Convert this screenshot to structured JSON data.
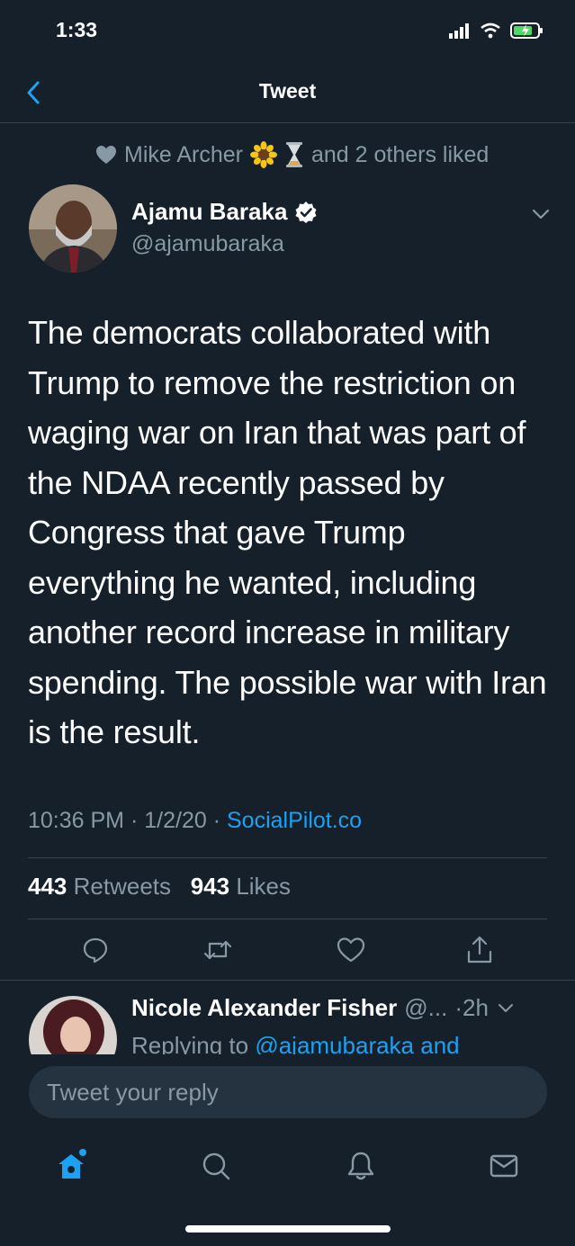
{
  "status_bar": {
    "time": "1:33"
  },
  "nav": {
    "title": "Tweet"
  },
  "social_context": {
    "liker": "Mike Archer",
    "suffix": "and 2 others liked"
  },
  "tweet": {
    "author_name": "Ajamu Baraka",
    "handle": "@ajamubaraka",
    "text": "The democrats collaborated with Trump to remove the restriction on waging war on Iran that was part of the NDAA recently passed by Congress that gave Trump everything he wanted, including another record increase in military spending. The possible war with Iran is the result.",
    "time": "10:36 PM",
    "date": "1/2/20",
    "source": "SocialPilot.co",
    "retweets_count": "443",
    "retweets_label": "Retweets",
    "likes_count": "943",
    "likes_label": "Likes"
  },
  "reply_preview": {
    "name": "Nicole Alexander Fisher",
    "handle": "@...",
    "age": "·2h",
    "replying_prefix": "Replying to",
    "replying_to": "@ajamubaraka and"
  },
  "compose": {
    "placeholder": "Tweet your reply"
  },
  "colors": {
    "background": "#15202b",
    "accent": "#1da1f2",
    "muted": "#8899a6",
    "divider": "#38444d"
  },
  "icons": {
    "actions": [
      "reply-icon",
      "retweet-icon",
      "like-icon",
      "share-icon"
    ],
    "tabs": [
      "home-icon",
      "search-icon",
      "notifications-icon",
      "messages-icon"
    ]
  }
}
